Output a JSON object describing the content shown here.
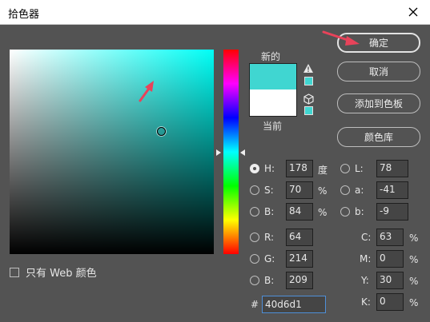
{
  "window": {
    "title": "拾色器"
  },
  "buttons": {
    "ok": "确定",
    "cancel": "取消",
    "add_swatch": "添加到色板",
    "libraries": "颜色库"
  },
  "preview": {
    "new_label": "新的",
    "current_label": "当前",
    "new_color": "#40d6d1",
    "current_color": "#ffffff"
  },
  "websafe": {
    "label": "只有 Web 颜色",
    "checked": false
  },
  "hsb": {
    "h": {
      "label": "H:",
      "value": "178",
      "unit": "度",
      "selected": true
    },
    "s": {
      "label": "S:",
      "value": "70",
      "unit": "%"
    },
    "b": {
      "label": "B:",
      "value": "84",
      "unit": "%"
    }
  },
  "lab": {
    "l": {
      "label": "L:",
      "value": "78"
    },
    "a": {
      "label": "a:",
      "value": "-41"
    },
    "b": {
      "label": "b:",
      "value": "-9"
    }
  },
  "rgb": {
    "r": {
      "label": "R:",
      "value": "64"
    },
    "g": {
      "label": "G:",
      "value": "214"
    },
    "b": {
      "label": "B:",
      "value": "209"
    }
  },
  "cmyk": {
    "c": {
      "label": "C:",
      "value": "63",
      "unit": "%"
    },
    "m": {
      "label": "M:",
      "value": "0",
      "unit": "%"
    },
    "y": {
      "label": "Y:",
      "value": "30",
      "unit": "%"
    },
    "k": {
      "label": "K:",
      "value": "0",
      "unit": "%"
    }
  },
  "hex": {
    "label": "#",
    "value": "40d6d1"
  },
  "colors": {
    "hue_color": "#00fff6",
    "annotation_arrow": "#e8435a"
  }
}
